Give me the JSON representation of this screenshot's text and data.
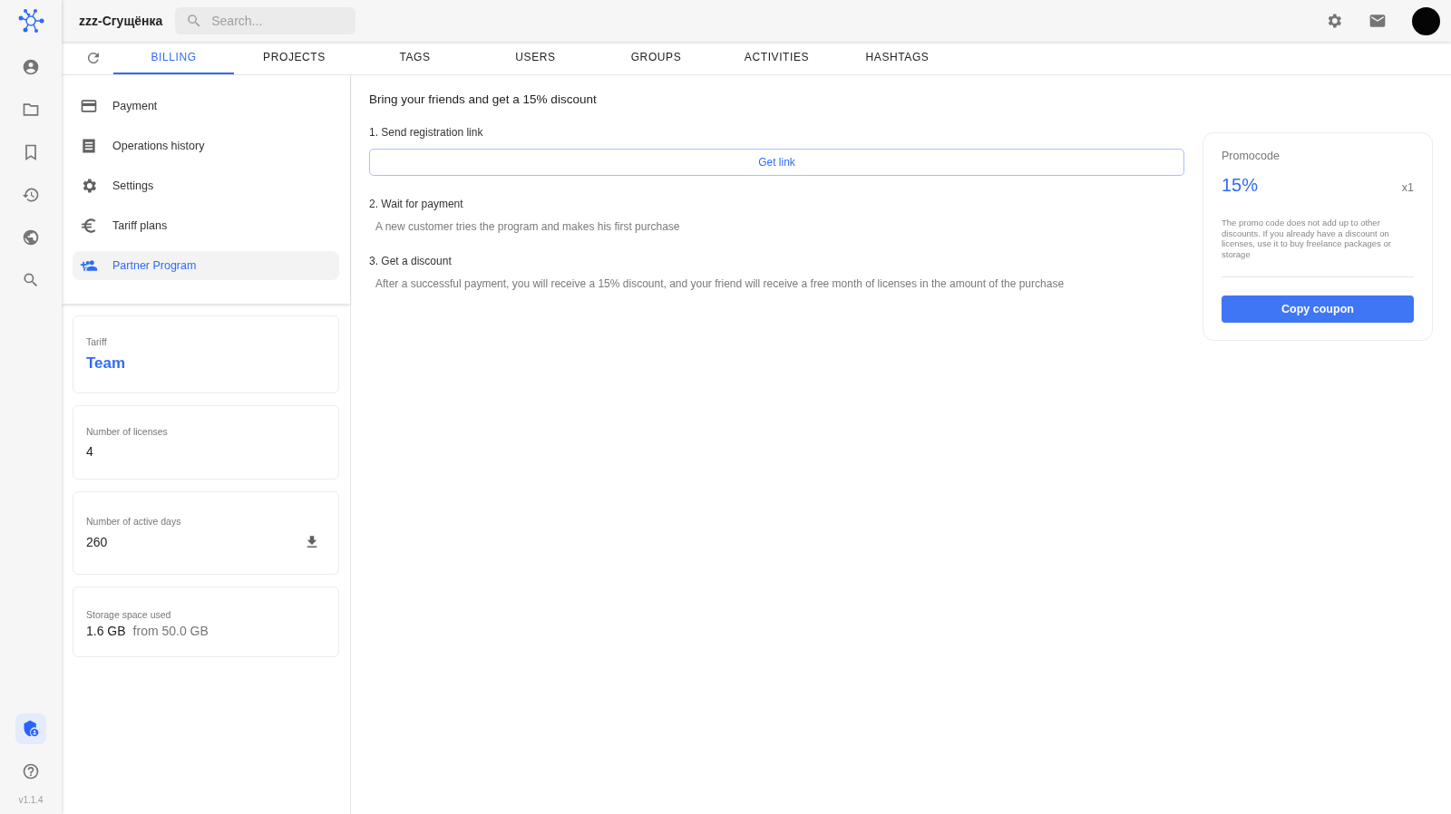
{
  "app": {
    "workspace": "zzz-Сгущёнка",
    "search": {
      "placeholder": "Search..."
    },
    "version": "v1.1.4"
  },
  "rail": [
    {
      "kind": "account",
      "selected": false
    },
    {
      "kind": "folder",
      "selected": false
    },
    {
      "kind": "bookmark",
      "selected": false
    },
    {
      "kind": "history",
      "selected": false
    },
    {
      "kind": "globe",
      "selected": false
    },
    {
      "kind": "search",
      "selected": false
    }
  ],
  "rail_bottom": [
    {
      "kind": "shield",
      "selected": true
    },
    {
      "kind": "help",
      "selected": false
    }
  ],
  "tabs": [
    {
      "label": "BILLING",
      "selected": true
    },
    {
      "label": "PROJECTS",
      "selected": false
    },
    {
      "label": "TAGS",
      "selected": false
    },
    {
      "label": "USERS",
      "selected": false
    },
    {
      "label": "GROUPS",
      "selected": false
    },
    {
      "label": "ACTIVITIES",
      "selected": false
    },
    {
      "label": "HASHTAGS",
      "selected": false
    }
  ],
  "menu": [
    {
      "label": "Payment",
      "kind": "card",
      "selected": false
    },
    {
      "label": "Operations history",
      "kind": "list",
      "selected": false
    },
    {
      "label": "Settings",
      "kind": "gear",
      "selected": false
    },
    {
      "label": "Tariff plans",
      "kind": "euro",
      "selected": false
    },
    {
      "label": "Partner Program",
      "kind": "people",
      "selected": true
    }
  ],
  "cards": [
    {
      "kind": "tariff",
      "label": "Tariff",
      "value": "Team"
    },
    {
      "kind": "plain",
      "label": "Number of licenses",
      "value": "4"
    },
    {
      "kind": "download",
      "label": "Number of active days",
      "value": "260"
    },
    {
      "kind": "storage",
      "label": "Storage space used",
      "value": "1.6 GB",
      "extra": "from 50.0 GB"
    }
  ],
  "partner": {
    "title": "Bring your friends and get a 15% discount",
    "steps": [
      {
        "title": "1. Send registration link",
        "kind": "button",
        "text": "Get link"
      },
      {
        "title": "2. Wait for payment",
        "kind": "note",
        "text": "A new customer tries the program and makes his first purchase"
      },
      {
        "title": "3. Get a discount",
        "kind": "note",
        "text": "After a successful payment, you will receive a 15% discount, and your friend will receive a free month of licenses in the amount of the purchase"
      }
    ]
  },
  "promo": {
    "label": "Promocode",
    "discount": "15%",
    "count": "x1",
    "note": "The promo code does not add up to other discounts. If you already have a discount on licenses, use it to buy freelance packages or storage",
    "button": "Copy coupon"
  }
}
